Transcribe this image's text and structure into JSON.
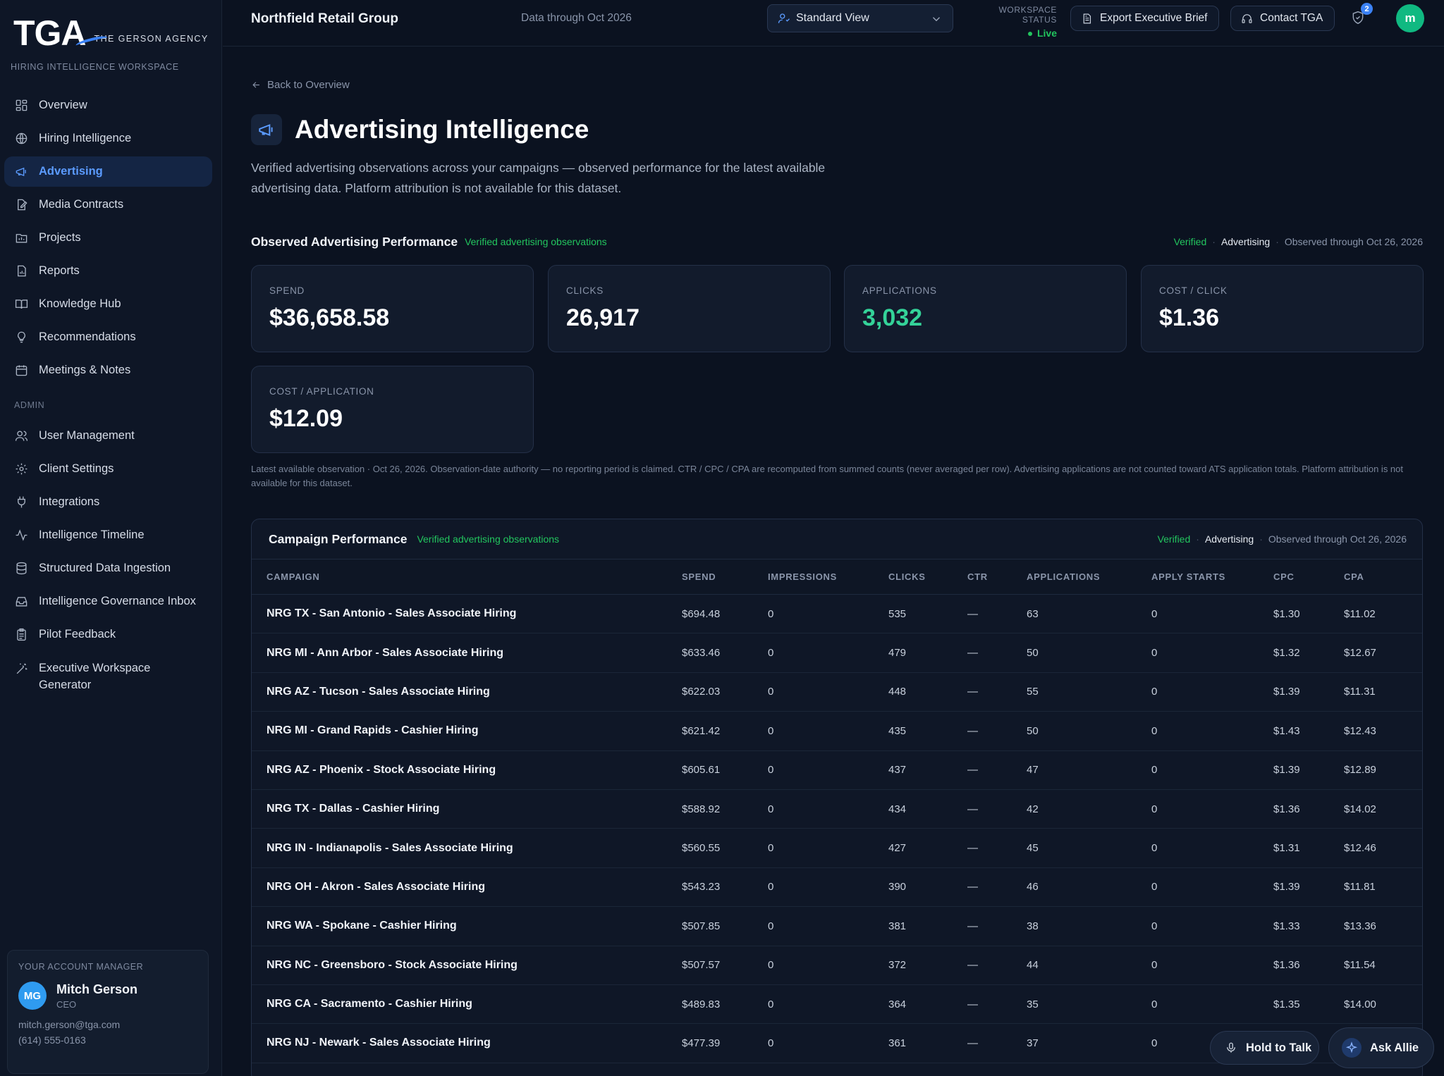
{
  "brand": {
    "logo": "TGA",
    "name": "THE GERSON AGENCY",
    "subtitle": "HIRING INTELLIGENCE WORKSPACE"
  },
  "sidebar": {
    "items": [
      {
        "label": "Overview",
        "icon": "grid-icon"
      },
      {
        "label": "Hiring Intelligence",
        "icon": "globe-icon"
      },
      {
        "label": "Advertising",
        "icon": "megaphone-icon",
        "active": true
      },
      {
        "label": "Media Contracts",
        "icon": "file-edit-icon"
      },
      {
        "label": "Projects",
        "icon": "folder-chart-icon"
      },
      {
        "label": "Reports",
        "icon": "report-icon"
      },
      {
        "label": "Knowledge Hub",
        "icon": "book-icon"
      },
      {
        "label": "Recommendations",
        "icon": "lightbulb-icon"
      },
      {
        "label": "Meetings & Notes",
        "icon": "calendar-icon"
      }
    ],
    "admin_label": "ADMIN",
    "admin_items": [
      {
        "label": "User Management",
        "icon": "users-icon"
      },
      {
        "label": "Client Settings",
        "icon": "gear-icon"
      },
      {
        "label": "Integrations",
        "icon": "plug-icon"
      },
      {
        "label": "Intelligence Timeline",
        "icon": "activity-icon"
      },
      {
        "label": "Structured Data Ingestion",
        "icon": "database-icon"
      },
      {
        "label": "Intelligence Governance Inbox",
        "icon": "inbox-icon"
      },
      {
        "label": "Pilot Feedback",
        "icon": "clipboard-icon"
      },
      {
        "label": "Executive Workspace Generator",
        "icon": "magic-wand-icon"
      }
    ]
  },
  "account_manager": {
    "label": "YOUR ACCOUNT MANAGER",
    "initials": "MG",
    "name": "Mitch Gerson",
    "role": "CEO",
    "email": "mitch.gerson@tga.com",
    "phone": "(614) 555-0163"
  },
  "topbar": {
    "client": "Northfield Retail Group",
    "data_through": "Data through Oct 2026",
    "view_selector": "Standard View",
    "workspace_status_label": "WORKSPACE STATUS",
    "workspace_status": "Live",
    "export_label": "Export Executive Brief",
    "contact_label": "Contact TGA",
    "notification_count": "2",
    "user_initial": "m"
  },
  "page": {
    "back_label": "Back to Overview",
    "title": "Advertising Intelligence",
    "description": "Verified advertising observations across your campaigns — observed performance for the latest available advertising data. Platform attribution is not available for this dataset."
  },
  "performance": {
    "title": "Observed Advertising Performance",
    "verified_label": "Verified advertising observations",
    "meta": {
      "verified": "Verified",
      "category": "Advertising",
      "observed": "Observed through Oct 26, 2026"
    },
    "kpis": [
      {
        "label": "SPEND",
        "value": "$36,658.58"
      },
      {
        "label": "CLICKS",
        "value": "26,917"
      },
      {
        "label": "APPLICATIONS",
        "value": "3,032"
      },
      {
        "label": "COST / CLICK",
        "value": "$1.36"
      },
      {
        "label": "COST / APPLICATION",
        "value": "$12.09"
      }
    ],
    "note": "Latest available observation · Oct 26, 2026. Observation-date authority — no reporting period is claimed. CTR / CPC / CPA are recomputed from summed counts (never averaged per row). Advertising applications are not counted toward ATS application totals. Platform attribution is not available for this dataset."
  },
  "campaigns": {
    "title": "Campaign Performance",
    "verified_label": "Verified advertising observations",
    "meta": {
      "verified": "Verified",
      "category": "Advertising",
      "observed": "Observed through Oct 26, 2026"
    },
    "columns": [
      "CAMPAIGN",
      "SPEND",
      "IMPRESSIONS",
      "CLICKS",
      "CTR",
      "APPLICATIONS",
      "APPLY STARTS",
      "CPC",
      "CPA"
    ],
    "rows": [
      [
        "NRG TX - San Antonio - Sales Associate Hiring",
        "$694.48",
        "0",
        "535",
        "—",
        "63",
        "0",
        "$1.30",
        "$11.02"
      ],
      [
        "NRG MI - Ann Arbor - Sales Associate Hiring",
        "$633.46",
        "0",
        "479",
        "—",
        "50",
        "0",
        "$1.32",
        "$12.67"
      ],
      [
        "NRG AZ - Tucson - Sales Associate Hiring",
        "$622.03",
        "0",
        "448",
        "—",
        "55",
        "0",
        "$1.39",
        "$11.31"
      ],
      [
        "NRG MI - Grand Rapids - Cashier Hiring",
        "$621.42",
        "0",
        "435",
        "—",
        "50",
        "0",
        "$1.43",
        "$12.43"
      ],
      [
        "NRG AZ - Phoenix - Stock Associate Hiring",
        "$605.61",
        "0",
        "437",
        "—",
        "47",
        "0",
        "$1.39",
        "$12.89"
      ],
      [
        "NRG TX - Dallas - Cashier Hiring",
        "$588.92",
        "0",
        "434",
        "—",
        "42",
        "0",
        "$1.36",
        "$14.02"
      ],
      [
        "NRG IN - Indianapolis - Sales Associate Hiring",
        "$560.55",
        "0",
        "427",
        "—",
        "45",
        "0",
        "$1.31",
        "$12.46"
      ],
      [
        "NRG OH - Akron - Sales Associate Hiring",
        "$543.23",
        "0",
        "390",
        "—",
        "46",
        "0",
        "$1.39",
        "$11.81"
      ],
      [
        "NRG WA - Spokane - Cashier Hiring",
        "$507.85",
        "0",
        "381",
        "—",
        "38",
        "0",
        "$1.33",
        "$13.36"
      ],
      [
        "NRG NC - Greensboro - Stock Associate Hiring",
        "$507.57",
        "0",
        "372",
        "—",
        "44",
        "0",
        "$1.36",
        "$11.54"
      ],
      [
        "NRG CA - Sacramento - Cashier Hiring",
        "$489.83",
        "0",
        "364",
        "—",
        "35",
        "0",
        "$1.35",
        "$14.00"
      ],
      [
        "NRG NJ - Newark - Sales Associate Hiring",
        "$477.39",
        "0",
        "361",
        "—",
        "37",
        "0",
        "",
        ""
      ]
    ]
  },
  "floating": {
    "hold_to_talk": "Hold to Talk",
    "ask_allie": "Ask Allie"
  }
}
